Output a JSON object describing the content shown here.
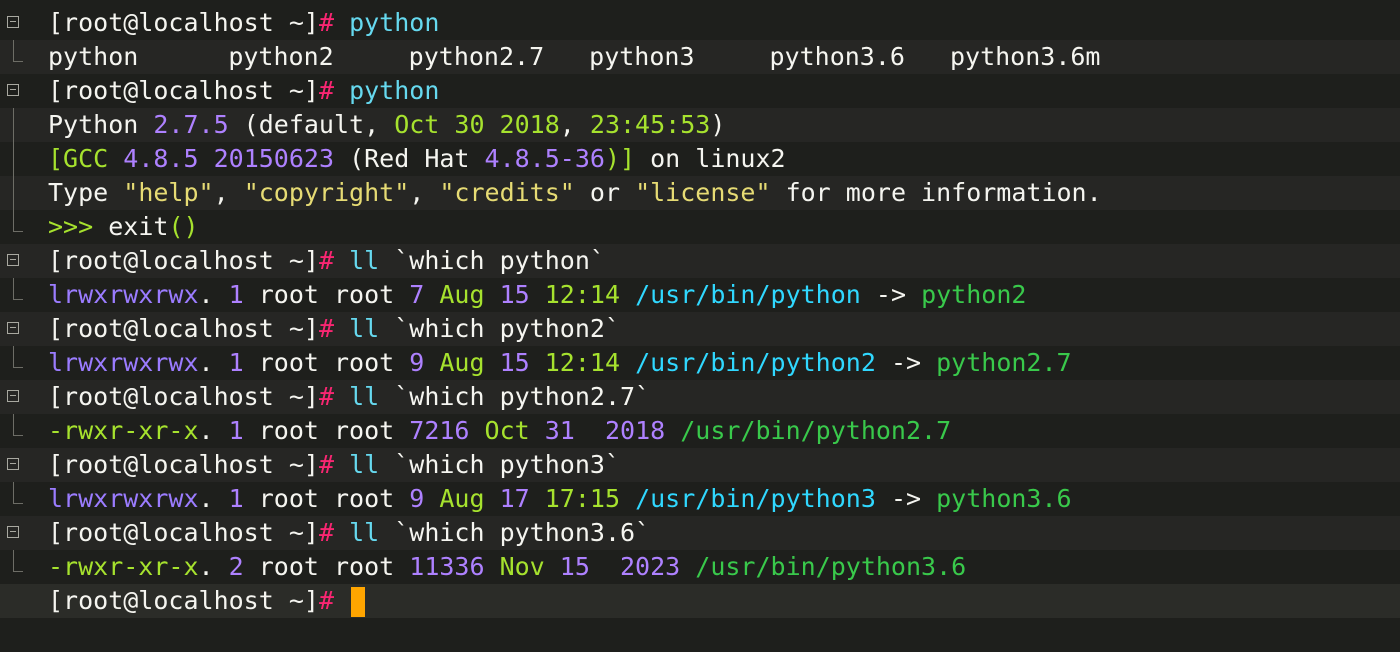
{
  "colors": {
    "background": "#1e1f1c",
    "prompt_hash": "#f92672",
    "command": "#66d9ef",
    "cursor": "#ffa500",
    "link_path": "#30d8ff",
    "link_target": "#39c94b"
  },
  "prompt": "[root@localhost ~]",
  "hash": "#",
  "lines": {
    "l1_cmd": "python",
    "l2_completions": [
      "python",
      "python2",
      "python2.7",
      "python3",
      "python3.6",
      "python3.6m"
    ],
    "l3_cmd": "python",
    "l4": {
      "a": "Python ",
      "ver": "2.7.5",
      "b": " (default, ",
      "date": "Oct 30 2018",
      "c": ", ",
      "time": "23:45:53",
      "d": ")"
    },
    "l5": {
      "a": "[GCC ",
      "v1": "4.8.5",
      "sp": " ",
      "v2": "20150623",
      "b": " (Red Hat ",
      "v3": "4.8.5-36",
      "c": ")]",
      "d": " on linux2"
    },
    "l6": {
      "a": "Type ",
      "s1": "\"help\"",
      "c1": ", ",
      "s2": "\"copyright\"",
      "c2": ", ",
      "s3": "\"credits\"",
      "b": " or ",
      "s4": "\"license\"",
      "c": " for more information."
    },
    "l7": {
      "prompt": ">>> ",
      "call": "exit",
      "paren": "()"
    },
    "l8_cmd": "ll",
    "l8_arg": " `which python`",
    "l9": {
      "perm": "lrwxrwxrwx",
      "dot": ". ",
      "n": "1",
      "owner": " root root ",
      "size": "7",
      "month": " Aug ",
      "day": "15",
      "time": " 12:14 ",
      "path": "/usr/bin/python",
      "arrow": " -> ",
      "target": "python2"
    },
    "l10_cmd": "ll",
    "l10_arg": " `which python2`",
    "l11": {
      "perm": "lrwxrwxrwx",
      "dot": ". ",
      "n": "1",
      "owner": " root root ",
      "size": "9",
      "month": " Aug ",
      "day": "15",
      "time": " 12:14 ",
      "path": "/usr/bin/python2",
      "arrow": " -> ",
      "target": "python2.7"
    },
    "l12_cmd": "ll",
    "l12_arg": " `which python2.7`",
    "l13": {
      "perm": "-rwxr-xr-x",
      "dot": ". ",
      "n": "1",
      "owner": " root root ",
      "size": "7216",
      "month": " Oct ",
      "day": "31",
      "year": "  2018 ",
      "path": "/usr/bin/python2.7"
    },
    "l14_cmd": "ll",
    "l14_arg": " `which python3`",
    "l15": {
      "perm": "lrwxrwxrwx",
      "dot": ". ",
      "n": "1",
      "owner": " root root ",
      "size": "9",
      "month": " Aug ",
      "day": "17",
      "time": " 17:15 ",
      "path": "/usr/bin/python3",
      "arrow": " -> ",
      "target": "python3.6"
    },
    "l16_cmd": "ll",
    "l16_arg": " `which python3.6`",
    "l17": {
      "perm": "-rwxr-xr-x",
      "dot": ". ",
      "n": "2",
      "owner": " root root ",
      "size": "11336",
      "month": " Nov ",
      "day": "15",
      "year": "  2023 ",
      "path": "/usr/bin/python3.6"
    }
  }
}
